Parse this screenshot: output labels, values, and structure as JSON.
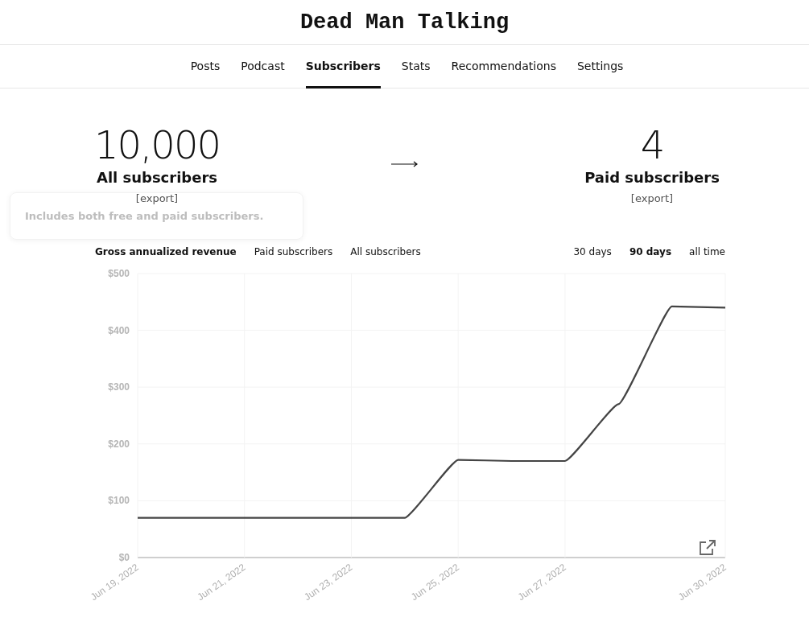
{
  "title": "Dead Man Talking",
  "nav": [
    {
      "label": "Posts",
      "selected": false
    },
    {
      "label": "Podcast",
      "selected": false
    },
    {
      "label": "Subscribers",
      "selected": true
    },
    {
      "label": "Stats",
      "selected": false
    },
    {
      "label": "Recommendations",
      "selected": false
    },
    {
      "label": "Settings",
      "selected": false
    }
  ],
  "stats": [
    {
      "value": "10,000",
      "label": "All subscribers",
      "export": "[export]"
    },
    {
      "value": "4",
      "label": "Paid subscribers",
      "export": "[export]"
    }
  ],
  "tooltip": "Includes both free and paid subscribers.",
  "chart_tabs": [
    {
      "label": "Gross annualized revenue",
      "selected": true
    },
    {
      "label": "Paid subscribers",
      "selected": false
    },
    {
      "label": "All subscribers",
      "selected": false
    }
  ],
  "ranges": [
    {
      "label": "30 days",
      "selected": false
    },
    {
      "label": "90 days",
      "selected": true
    },
    {
      "label": "all time",
      "selected": false
    }
  ],
  "chart_data": {
    "type": "line",
    "categories": [
      "Jun 19, 2022",
      null,
      "Jun 21, 2022",
      null,
      "Jun 23, 2022",
      null,
      "Jun 25, 2022",
      null,
      "Jun 27, 2022",
      null,
      null,
      "Jun 30, 2022"
    ],
    "series": [
      {
        "color": "#444444",
        "values": [
          70,
          70,
          70,
          70,
          70,
          70,
          172,
          170,
          170,
          270,
          442,
          440
        ]
      }
    ],
    "ylim": [
      0,
      500
    ],
    "grid": true,
    "yticks": [
      {
        "value": 0,
        "label": "$0"
      },
      {
        "value": 100,
        "label": "$100"
      },
      {
        "value": 200,
        "label": "$200"
      },
      {
        "value": 300,
        "label": "$300"
      },
      {
        "value": 400,
        "label": "$400"
      },
      {
        "value": 500,
        "label": "$500"
      }
    ]
  }
}
